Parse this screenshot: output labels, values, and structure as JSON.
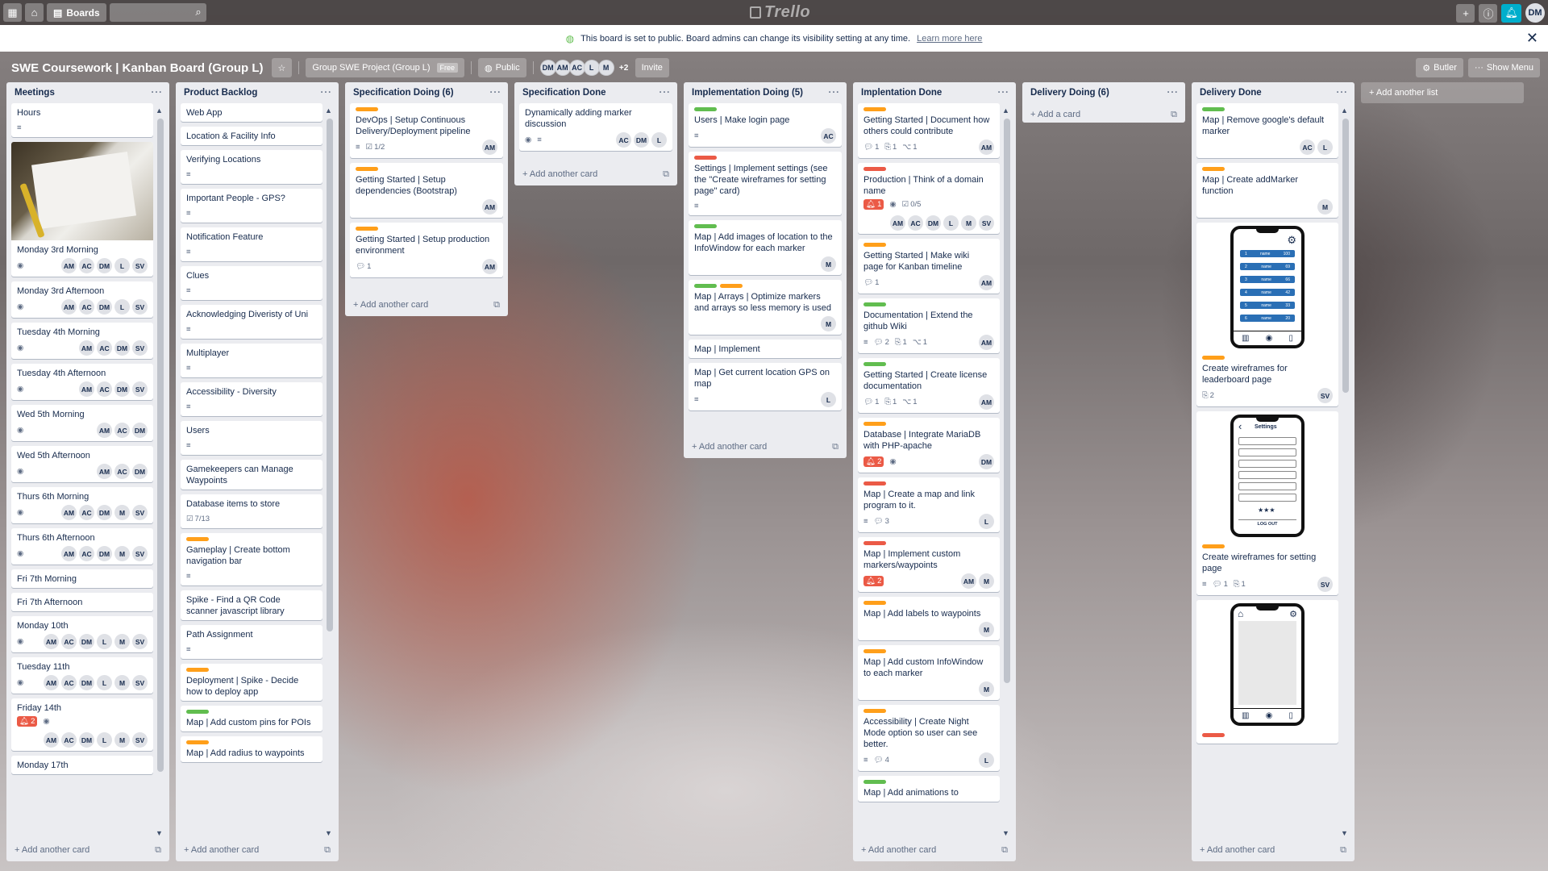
{
  "topbar": {
    "boards_label": "Boards",
    "logo_text": "Trello",
    "user_initials": "DM"
  },
  "banner": {
    "message": "This board is set to public. Board admins can change its visibility setting at any time.",
    "link": "Learn more here"
  },
  "header": {
    "title": "SWE Coursework | Kanban Board (Group L)",
    "team": "Group SWE Project (Group L)",
    "team_badge": "Free",
    "visibility": "Public",
    "members": [
      "DM",
      "AM",
      "AC",
      "L",
      "M"
    ],
    "members_more": "+2",
    "invite": "Invite",
    "butler": "Butler",
    "show_menu": "Show Menu"
  },
  "add_list_label": "+ Add another list",
  "lists": [
    {
      "title": "Meetings",
      "add_label": "+ Add another card",
      "cards": [
        {
          "title": "Hours",
          "badges": [
            "desc"
          ]
        },
        {
          "title": "Monday 3rd Morning",
          "cover": "photo",
          "badges": [
            "watch"
          ],
          "members": [
            "AM",
            "AC",
            "DM",
            "L",
            "SV"
          ]
        },
        {
          "title": "Monday 3rd Afternoon",
          "badges": [
            "watch"
          ],
          "members": [
            "AM",
            "AC",
            "DM",
            "L",
            "SV"
          ]
        },
        {
          "title": "Tuesday 4th Morning",
          "badges": [
            "watch"
          ],
          "members": [
            "AM",
            "AC",
            "DM",
            "SV"
          ]
        },
        {
          "title": "Tuesday 4th Afternoon",
          "badges": [
            "watch"
          ],
          "members": [
            "AM",
            "AC",
            "DM",
            "SV"
          ]
        },
        {
          "title": "Wed 5th Morning",
          "badges": [
            "watch"
          ],
          "members": [
            "AM",
            "AC",
            "DM"
          ]
        },
        {
          "title": "Wed 5th Afternoon",
          "badges": [
            "watch"
          ],
          "members": [
            "AM",
            "AC",
            "DM"
          ]
        },
        {
          "title": "Thurs 6th Morning",
          "badges": [
            "watch"
          ],
          "members": [
            "AM",
            "AC",
            "DM",
            "M",
            "SV"
          ]
        },
        {
          "title": "Thurs 6th Afternoon",
          "badges": [
            "watch"
          ],
          "members": [
            "AM",
            "AC",
            "DM",
            "M",
            "SV"
          ]
        },
        {
          "title": "Fri 7th Morning"
        },
        {
          "title": "Fri 7th Afternoon"
        },
        {
          "title": "Monday 10th",
          "badges": [
            "watch"
          ],
          "members": [
            "AM",
            "AC",
            "DM",
            "L",
            "M",
            "SV"
          ]
        },
        {
          "title": "Tuesday 11th",
          "badges": [
            "watch"
          ],
          "members": [
            "AM",
            "AC",
            "DM",
            "L",
            "M",
            "SV"
          ]
        },
        {
          "title": "Friday 14th",
          "alert": "2",
          "badges": [
            "watch"
          ],
          "members": [
            "AM",
            "AC",
            "DM",
            "L",
            "M",
            "SV"
          ]
        },
        {
          "title": "Monday 17th"
        }
      ]
    },
    {
      "title": "Product Backlog",
      "add_label": "+ Add another card",
      "cards": [
        {
          "title": "Web App"
        },
        {
          "title": "Location & Facility Info"
        },
        {
          "title": "Verifying Locations",
          "badges": [
            "desc"
          ]
        },
        {
          "title": "Important People - GPS?",
          "badges": [
            "desc"
          ]
        },
        {
          "title": "Notification Feature",
          "badges": [
            "desc"
          ]
        },
        {
          "title": "Clues",
          "badges": [
            "desc"
          ]
        },
        {
          "title": "Acknowledging Diveristy of Uni",
          "badges": [
            "desc"
          ]
        },
        {
          "title": "Multiplayer",
          "badges": [
            "desc"
          ]
        },
        {
          "title": "Accessibility - Diversity",
          "badges": [
            "desc"
          ]
        },
        {
          "title": "Users",
          "badges": [
            "desc"
          ]
        },
        {
          "title": "Gamekeepers can Manage Waypoints"
        },
        {
          "title": "Database items to store",
          "checklist": "7/13"
        },
        {
          "title": "Gameplay | Create bottom navigation bar",
          "labels": [
            "orange"
          ],
          "badges": [
            "desc"
          ]
        },
        {
          "title": "Spike - Find a QR Code scanner javascript library"
        },
        {
          "title": "Path Assignment",
          "badges": [
            "desc"
          ]
        },
        {
          "title": "Deployment | Spike - Decide how to deploy app",
          "labels": [
            "orange"
          ]
        },
        {
          "title": "Map | Add custom pins for POIs",
          "labels": [
            "green"
          ]
        },
        {
          "title": "Map | Add radius to waypoints",
          "labels": [
            "orange"
          ]
        }
      ]
    },
    {
      "title": "Specification Doing (6)",
      "add_label": "+ Add another card",
      "cards": [
        {
          "title": "DevOps | Setup Continuous Delivery/Deployment pipeline",
          "labels": [
            "orange"
          ],
          "badges": [
            "desc"
          ],
          "checklist": "1/2",
          "members": [
            "AM"
          ]
        },
        {
          "title": "Getting Started | Setup dependencies (Bootstrap)",
          "labels": [
            "orange"
          ],
          "members": [
            "AM"
          ]
        },
        {
          "title": "Getting Started | Setup production environment",
          "labels": [
            "orange"
          ],
          "comments": "1",
          "members": [
            "AM"
          ]
        }
      ]
    },
    {
      "title": "Specification Done",
      "add_label": "+ Add another card",
      "cards": [
        {
          "title": "Dynamically adding marker discussion",
          "badges": [
            "watch",
            "desc"
          ],
          "members": [
            "AC",
            "DM",
            "L"
          ]
        }
      ]
    },
    {
      "title": "Implementation Doing (5)",
      "add_label": "+ Add another card",
      "cards": [
        {
          "title": "Users | Make login page",
          "labels": [
            "green"
          ],
          "badges": [
            "desc"
          ],
          "members": [
            "AC"
          ]
        },
        {
          "title": "Settings | Implement settings (see the \"Create wireframes for setting page\" card)",
          "labels": [
            "red"
          ],
          "badges": [
            "desc"
          ]
        },
        {
          "title": "Map | Add images of location to the InfoWindow for each marker",
          "labels": [
            "green"
          ],
          "members": [
            "M"
          ]
        },
        {
          "title": "Map | Arrays | Optimize markers and arrays so less memory is used",
          "labels": [
            "green",
            "orange"
          ],
          "members": [
            "M"
          ]
        },
        {
          "title": "Map | Implement"
        },
        {
          "title": "Map | Get current location GPS on map",
          "badges": [
            "desc"
          ],
          "members": [
            "L"
          ]
        }
      ]
    },
    {
      "title": "Implentation Done",
      "add_label": "+ Add another card",
      "cards": [
        {
          "title": "Getting Started | Document how others could contribute",
          "labels": [
            "orange"
          ],
          "comments": "1",
          "attachments": "1",
          "github": "1",
          "members": [
            "AM"
          ]
        },
        {
          "title": "Production | Think of a domain name",
          "labels": [
            "red"
          ],
          "alert": "1",
          "badges": [
            "watch"
          ],
          "checklist": "0/5",
          "members": [
            "AM",
            "AC",
            "DM",
            "L",
            "M",
            "SV"
          ]
        },
        {
          "title": "Getting Started | Make wiki page for Kanban timeline",
          "labels": [
            "orange"
          ],
          "comments": "1",
          "members": [
            "AM"
          ]
        },
        {
          "title": "Documentation | Extend the github Wiki",
          "labels": [
            "green"
          ],
          "badges": [
            "desc"
          ],
          "comments": "2",
          "attachments": "1",
          "github": "1",
          "members": [
            "AM"
          ]
        },
        {
          "title": "Getting Started | Create license documentation",
          "labels": [
            "green"
          ],
          "comments": "1",
          "attachments": "1",
          "github": "1",
          "members": [
            "AM"
          ]
        },
        {
          "title": "Database | Integrate MariaDB with PHP-apache",
          "labels": [
            "orange"
          ],
          "alert": "2",
          "badges": [
            "watch"
          ],
          "members": [
            "DM"
          ]
        },
        {
          "title": "Map | Create a map and link program to it.",
          "labels": [
            "red"
          ],
          "badges": [
            "desc"
          ],
          "comments": "3",
          "members": [
            "L"
          ]
        },
        {
          "title": "Map | Implement custom markers/waypoints",
          "labels": [
            "red"
          ],
          "alert": "2",
          "members": [
            "AM",
            "M"
          ]
        },
        {
          "title": "Map | Add labels to waypoints",
          "labels": [
            "orange"
          ],
          "members": [
            "M"
          ]
        },
        {
          "title": "Map | Add custom InfoWindow to each marker",
          "labels": [
            "orange"
          ],
          "members": [
            "M"
          ]
        },
        {
          "title": "Accessibility | Create Night Mode option so user can see better.",
          "labels": [
            "orange"
          ],
          "badges": [
            "desc"
          ],
          "comments": "4",
          "members": [
            "L"
          ]
        },
        {
          "title": "Map | Add animations to",
          "labels": [
            "green"
          ]
        }
      ]
    },
    {
      "title": "Delivery Doing (6)",
      "add_label": "+ Add a card",
      "cards": []
    },
    {
      "title": "Delivery Done",
      "add_label": "+ Add another card",
      "cards": [
        {
          "title": "Map | Remove google's default marker",
          "labels": [
            "green"
          ],
          "members": [
            "AC",
            "L"
          ]
        },
        {
          "title": "Map | Create addMarker function",
          "labels": [
            "orange"
          ],
          "members": [
            "M"
          ]
        },
        {
          "title": "Create wireframes for leaderboard page",
          "cover": "phone-leaderboard",
          "labels": [
            "orange"
          ],
          "attachments": "2",
          "members": [
            "SV"
          ]
        },
        {
          "title": "Create wireframes for setting page",
          "cover": "phone-settings",
          "labels": [
            "orange"
          ],
          "badges": [
            "desc"
          ],
          "comments": "1",
          "attachments": "1",
          "members": [
            "SV"
          ]
        },
        {
          "title": "",
          "cover": "phone-map",
          "labels": [
            "red"
          ]
        }
      ]
    }
  ],
  "phone_text": {
    "leaderboard_rows": [
      [
        "1",
        "name",
        "100"
      ],
      [
        "2",
        "name",
        "69"
      ],
      [
        "3",
        "name",
        "66"
      ],
      [
        "4",
        "name",
        "42"
      ],
      [
        "5",
        "name",
        "33"
      ],
      [
        "6",
        "name",
        "20"
      ]
    ],
    "settings_title": "Settings",
    "logout": "LOG OUT"
  }
}
